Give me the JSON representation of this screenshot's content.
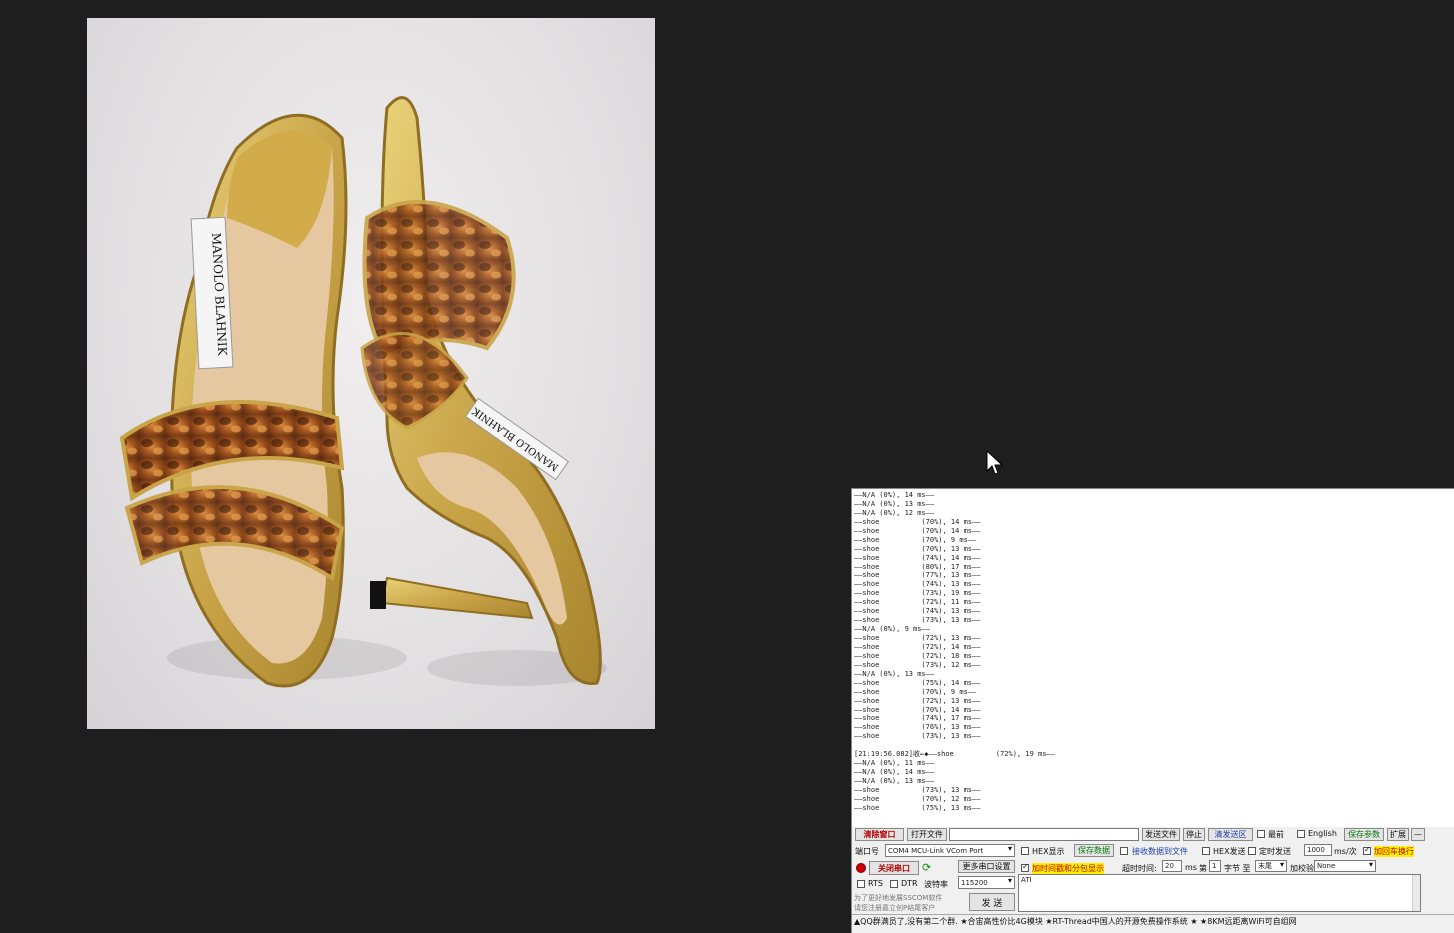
{
  "photo": {
    "label_left": "MANOLO BLAHNIK",
    "label_right": "MANOLO BLAHNIK"
  },
  "log_lines": [
    "——N/A (0%), 14 ms——",
    "——N/A (0%), 13 ms——",
    "——N/A (0%), 12 ms——",
    "——shoe          (70%), 14 ms——",
    "——shoe          (70%), 14 ms——",
    "——shoe          (70%), 9 ms——",
    "——shoe          (70%), 13 ms——",
    "——shoe          (74%), 14 ms——",
    "——shoe          (80%), 17 ms——",
    "——shoe          (77%), 13 ms——",
    "——shoe          (74%), 13 ms——",
    "——shoe          (73%), 19 ms——",
    "——shoe          (72%), 11 ms——",
    "——shoe          (74%), 13 ms——",
    "——shoe          (73%), 13 ms——",
    "——N/A (0%), 9 ms——",
    "——shoe          (72%), 13 ms——",
    "——shoe          (72%), 14 ms——",
    "——shoe          (72%), 18 ms——",
    "——shoe          (73%), 12 ms——",
    "——N/A (0%), 13 ms——",
    "——shoe          (75%), 14 ms——",
    "——shoe          (70%), 9 ms——",
    "——shoe          (72%), 13 ms——",
    "——shoe          (70%), 14 ms——",
    "——shoe          (74%), 17 ms——",
    "——shoe          (76%), 13 ms——",
    "——shoe          (73%), 13 ms——",
    "",
    "[21:19:56.082]收←◆——shoe          (72%), 19 ms——",
    "——N/A (0%), 11 ms——",
    "——N/A (0%), 14 ms——",
    "——N/A (0%), 13 ms——",
    "——shoe          (73%), 13 ms——",
    "——shoe          (70%), 12 ms——",
    "——shoe          (75%), 13 ms——"
  ],
  "toolbar": {
    "clear_window": "清除窗口",
    "open_file": "打开文件",
    "file_path": "",
    "send_file": "发送文件",
    "stop": "停止",
    "clear_send": "清发送区",
    "top_most": "最前",
    "english": "English",
    "save_params": "保存参数",
    "expand": "扩展",
    "collapse": "—"
  },
  "port": {
    "port_label": "端口号",
    "port_value": "COM4 MCU-Link VCom Port",
    "hex_display": "HEX显示",
    "save_data": "保存数据",
    "receive_to_file": "接收数据到文件",
    "hex_send": "HEX发送",
    "timed_send": "定时发送",
    "interval_value": "1000",
    "interval_unit": "ms/次",
    "append_newline": "加回车换行",
    "close_port": "关闭串口",
    "more_settings": "更多串口设置",
    "timestamp_split": "加时间戳和分包显示",
    "timeout_label": "超时时间:",
    "timeout_value": "20",
    "timeout_unit": "ms",
    "byte_label": "第",
    "byte_value": "1",
    "byte_unit": "字节 至",
    "tail_value": "末尾",
    "checksum_label": "加校验",
    "checksum_value": "None",
    "rts": "RTS",
    "dtr": "DTR",
    "baud_label": "波特率",
    "baud_value": "115200",
    "promo_line1": "为了更好地发展SSCOM软件",
    "promo_line2": "请您注册嘉立创P结尾客户",
    "send": "发 送",
    "send_text": "ATI"
  },
  "ticker": "▲QQ群满员了,没有第二个群. ★合宙高性价比4G模块 ★RT-Thread中国人的开源免费操作系统 ★ ★8KM远距离WiFi可自组网"
}
